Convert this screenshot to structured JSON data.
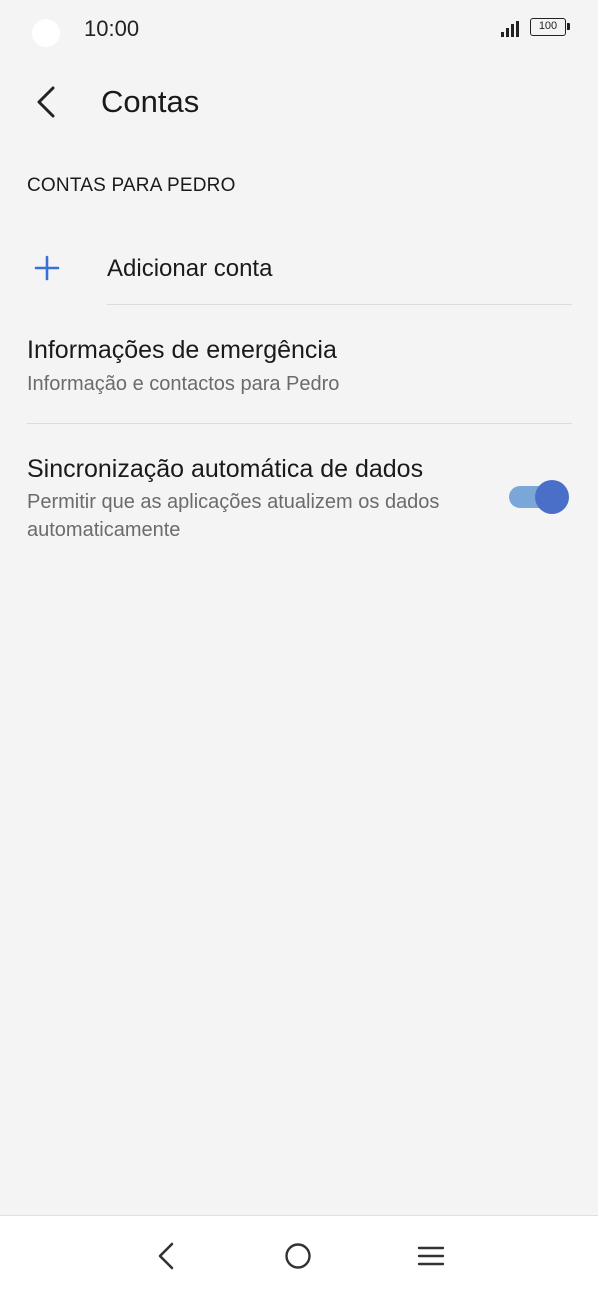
{
  "status_bar": {
    "time": "10:00",
    "battery": "100",
    "signal_icon": "signal-icon"
  },
  "header": {
    "back_icon": "chevron-left-icon",
    "title": "Contas"
  },
  "section": {
    "title": "CONTAS PARA PEDRO"
  },
  "add_account": {
    "icon": "plus-icon",
    "icon_color": "#3c6fd6",
    "label": "Adicionar conta"
  },
  "emergency": {
    "title": "Informações de emergência",
    "subtitle": "Informação e contactos para Pedro"
  },
  "auto_sync": {
    "title": "Sincronização automática de dados",
    "subtitle": "Permitir que as aplicações atualizem os dados automaticamente",
    "enabled": true,
    "toggle_color": "#4a6fc9"
  },
  "nav_bar": {
    "items": [
      "back-icon",
      "home-icon",
      "menu-icon"
    ]
  }
}
